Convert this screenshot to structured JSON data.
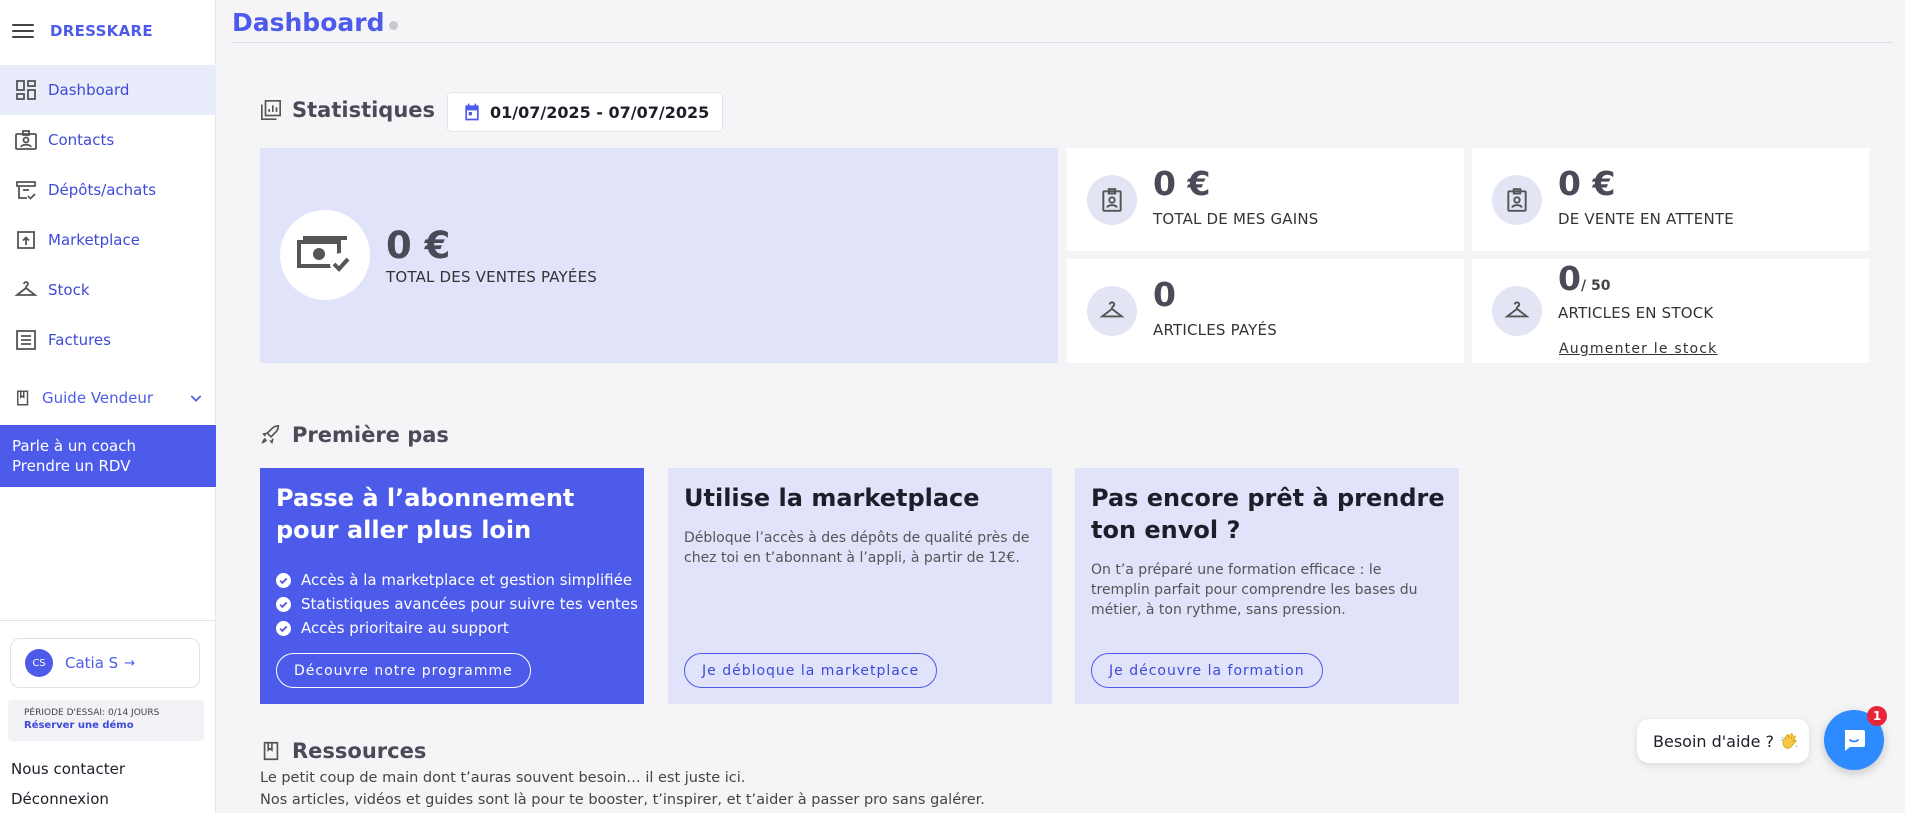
{
  "brand": "DRESSKARE",
  "sidebar": {
    "items": [
      {
        "label": "Dashboard",
        "icon": "dashboard-icon",
        "active": true
      },
      {
        "label": "Contacts",
        "icon": "contacts-icon"
      },
      {
        "label": "Dépôts/achats",
        "icon": "deposits-icon"
      },
      {
        "label": "Marketplace",
        "icon": "marketplace-icon"
      },
      {
        "label": "Stock",
        "icon": "hanger-icon"
      },
      {
        "label": "Factures",
        "icon": "invoice-icon"
      }
    ],
    "guide_label": "Guide Vendeur",
    "coach_line1": "Parle à un coach",
    "coach_line2": "Prendre un RDV",
    "user_initials": "CS",
    "user_name": "Catia S",
    "trial_label": "PÉRIODE D'ESSAI: 0/14 JOURS",
    "trial_link": "Réserver une démo",
    "contact_label": "Nous contacter",
    "logout_label": "Déconnexion"
  },
  "header": {
    "title": "Dashboard"
  },
  "stats": {
    "heading": "Statistiques",
    "date_range": "01/07/2025 - 07/07/2025",
    "total_sales_value": "0 €",
    "total_sales_label": "TOTAL DES VENTES PAYÉES",
    "gains_value": "0 €",
    "gains_label": "TOTAL DE MES GAINS",
    "pending_value": "0 €",
    "pending_label": "DE VENTE EN ATTENTE",
    "paid_articles_value": "0",
    "paid_articles_label": "ARTICLES PAYÉS",
    "stock_value": "0",
    "stock_max": "/ 50",
    "stock_label": "ARTICLES EN STOCK",
    "stock_link": "Augmenter le stock"
  },
  "first_steps": {
    "heading": "Première pas",
    "cards": [
      {
        "title": "Passe à l’abonnement pour aller plus loin",
        "bullets": [
          "Accès à la marketplace et gestion simplifiée",
          "Statistiques avancées pour suivre tes ventes",
          "Accès prioritaire au support"
        ],
        "button": "Découvre notre programme"
      },
      {
        "title": "Utilise la marketplace",
        "description": "Débloque l’accès à des dépôts de qualité près de chez toi en t’abonnant à l’appli, à partir de 12€.",
        "button": "Je débloque la marketplace"
      },
      {
        "title": "Pas encore prêt à prendre ton envol ?",
        "description": "On t’a préparé une formation efficace : le tremplin parfait pour comprendre les bases du métier, à ton rythme, sans pression.",
        "button": "Je découvre la formation"
      }
    ]
  },
  "resources": {
    "heading": "Ressources",
    "line1": "Le petit coup de main dont t’auras souvent besoin… il est juste ici.",
    "line2": "Nos articles, vidéos et guides sont là pour te booster, t’inspirer, et t’aider à passer pro sans galérer."
  },
  "help": {
    "bubble": "Besoin d'aide ?",
    "badge": "1"
  },
  "colors": {
    "accent": "#4d5bea",
    "soft": "#e1e3fb",
    "chat": "#2e8bff",
    "badge": "#e8253a"
  }
}
